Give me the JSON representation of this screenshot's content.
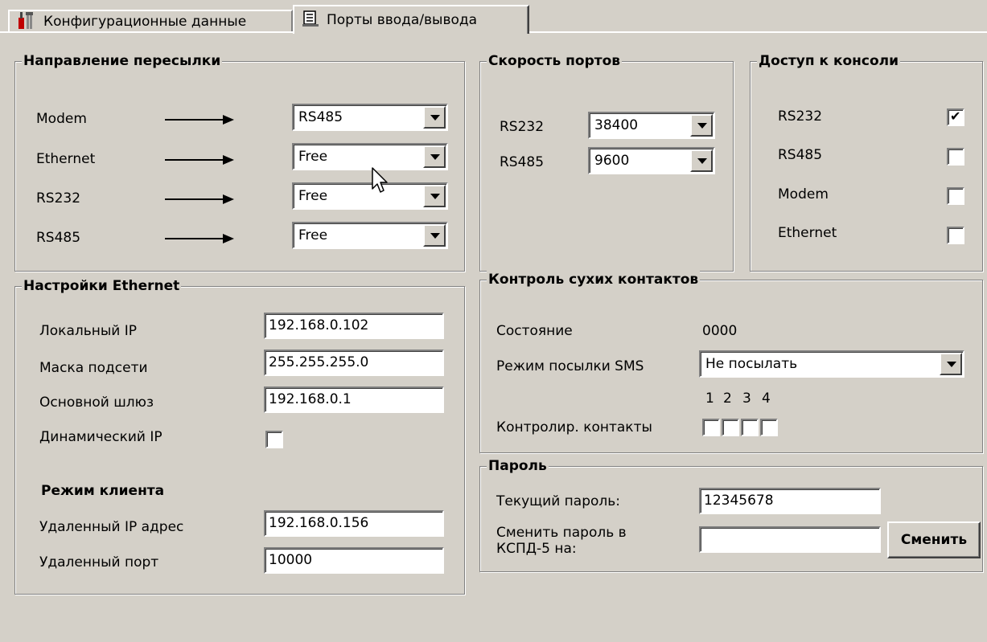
{
  "tabs": [
    {
      "label": "Конфигурационные данные",
      "icon": "tools-icon"
    },
    {
      "label": "Порты ввода/вывода",
      "icon": "ports-icon"
    }
  ],
  "forwarding": {
    "title": "Направление пересылки",
    "rows": [
      {
        "label": "Modem",
        "value": "RS485"
      },
      {
        "label": "Ethernet",
        "value": "Free"
      },
      {
        "label": "RS232",
        "value": "Free"
      },
      {
        "label": "RS485",
        "value": "Free"
      }
    ]
  },
  "port_speed": {
    "title": "Скорость портов",
    "rows": [
      {
        "label": "RS232",
        "value": "38400"
      },
      {
        "label": "RS485",
        "value": "9600"
      }
    ]
  },
  "console_access": {
    "title": "Доступ к консоли",
    "rows": [
      {
        "label": "RS232",
        "checked": true
      },
      {
        "label": "RS485",
        "checked": false
      },
      {
        "label": "Modem",
        "checked": false
      },
      {
        "label": "Ethernet",
        "checked": false
      }
    ]
  },
  "ethernet": {
    "title": "Настройки Ethernet",
    "local_ip_label": "Локальный IP",
    "local_ip": "192.168.0.102",
    "mask_label": "Маска подсети",
    "mask": "255.255.255.0",
    "gateway_label": "Основной шлюз",
    "gateway": "192.168.0.1",
    "dynamic_ip_label": "Динамический IP",
    "dynamic_ip": false,
    "client_mode_label": "Режим клиента",
    "remote_ip_label": "Удаленный IP адрес",
    "remote_ip": "192.168.0.156",
    "remote_port_label": "Удаленный порт",
    "remote_port": "10000"
  },
  "dry_contacts": {
    "title": "Контроль сухих контактов",
    "state_label": "Состояние",
    "state": "0000",
    "sms_mode_label": "Режим посылки SMS",
    "sms_mode": "Не посылать",
    "contacts_label": "Контролир. контакты",
    "contact_numbers": [
      "1",
      "2",
      "3",
      "4"
    ]
  },
  "password": {
    "title": "Пароль",
    "current_label": "Текущий пароль:",
    "current": "12345678",
    "change_label_line1": "Сменить пароль в",
    "change_label_line2": "КСПД-5 на:",
    "new_value": "",
    "change_button": "Сменить"
  }
}
